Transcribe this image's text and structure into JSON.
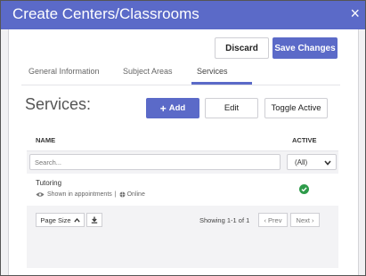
{
  "window": {
    "title": "Create Centers/Classrooms",
    "close_icon": "×"
  },
  "actions": {
    "discard": "Discard",
    "save": "Save Changes"
  },
  "tabs": [
    {
      "label": "General Information"
    },
    {
      "label": "Subject Areas"
    },
    {
      "label": "Services",
      "active": true
    }
  ],
  "services": {
    "heading": "Services:",
    "add_label": "Add",
    "edit_label": "Edit",
    "toggle_label": "Toggle Active"
  },
  "table": {
    "col_name": "NAME",
    "col_active": "ACTIVE",
    "search_placeholder": "Search...",
    "filter_value": "(All)",
    "rows": [
      {
        "name": "Tutoring",
        "shown": "Shown in appointments",
        "separator": "|",
        "mode": "Online",
        "active": true
      }
    ],
    "page_size_label": "Page Size",
    "showing": "Showing 1-1 of 1",
    "prev": "Prev",
    "next": "Next"
  },
  "colors": {
    "accent": "#5b6ac8",
    "active_check": "#2e9b4a"
  }
}
